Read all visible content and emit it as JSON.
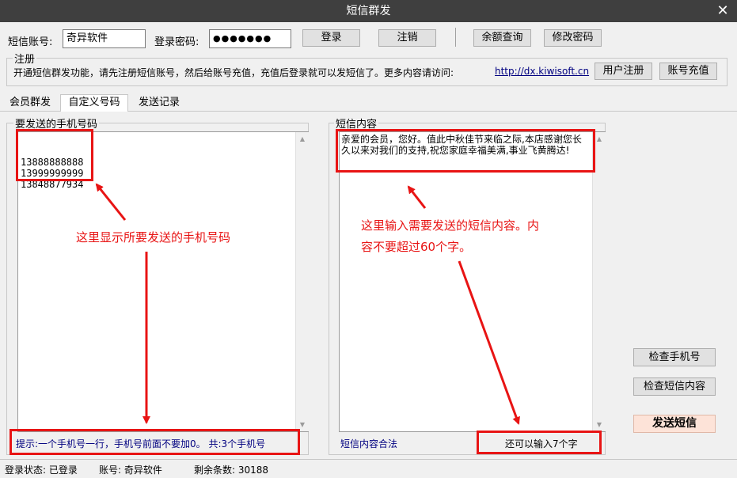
{
  "window": {
    "title": "短信群发"
  },
  "login": {
    "account_label": "短信账号:",
    "account_value": "奇异软件",
    "password_label": "登录密码:",
    "password_value": "●●●●●●●",
    "login_button": "登录",
    "logout_button": "注销",
    "balance_button": "余额查询",
    "change_password_button": "修改密码"
  },
  "register": {
    "legend": "注册",
    "text": "开通短信群发功能，请先注册短信账号，然后给账号充值，充值后登录就可以发短信了。更多内容请访问:",
    "link": "http://dx.kiwisoft.cn",
    "register_button": "用户注册",
    "recharge_button": "账号充值"
  },
  "tabs": [
    {
      "label": "会员群发",
      "active": false
    },
    {
      "label": "自定义号码",
      "active": true
    },
    {
      "label": "发送记录",
      "active": false
    }
  ],
  "phones": {
    "label": "要发送的手机号码",
    "numbers": "13888888888\n13999999999\n13848877934",
    "hint": "提示:一个手机号一行，手机号前面不要加0。 共:3个手机号",
    "annotation": "这里显示所要发送的手机号码"
  },
  "sms": {
    "label": "短信内容",
    "content": "亲爱的会员，您好。值此中秋佳节来临之际,本店感谢您长久以来对我们的支持,祝您家庭幸福美满,事业飞黄腾达!",
    "valid_text": "短信内容合法",
    "remaining_text": "还可以输入7个字",
    "annotation_line1": "这里输入需要发送的短信内容。内",
    "annotation_line2": "容不要超过60个字。"
  },
  "actions": {
    "check_phone": "检查手机号",
    "check_content": "检查短信内容",
    "send": "发送短信"
  },
  "status": {
    "login_state": "登录状态: 已登录",
    "account": "账号: 奇异软件",
    "remaining": "剩余条数: 30188"
  },
  "colors": {
    "title_bar": "#3f3f3f",
    "annotation_red": "#e81414",
    "link_blue": "#000080",
    "send_button_bg": "#fde3d8"
  }
}
